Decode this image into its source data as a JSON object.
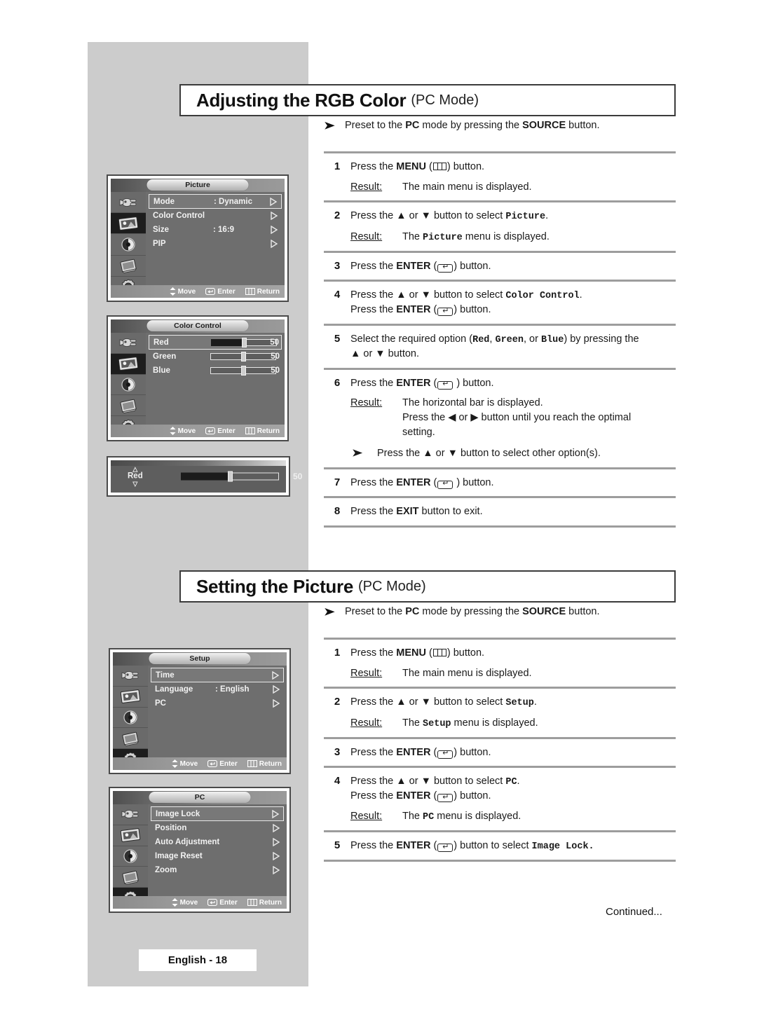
{
  "page": {
    "footer_label": "English - 18",
    "continued_label": "Continued..."
  },
  "sections": [
    {
      "id": "rgb",
      "title_main": "Adjusting the RGB Color",
      "title_sub": "(PC Mode)",
      "preset_note": {
        "arrow": "➤",
        "prefix": "Preset to the ",
        "bold1": "PC",
        "middle": " mode by pressing the ",
        "bold2": "SOURCE",
        "suffix": " button."
      },
      "steps": [
        {
          "num": "1",
          "text_parts": [
            "Press the ",
            "MENU",
            " (",
            "menu-icon",
            ") button."
          ],
          "result_label": "Result:",
          "result_text": "The main menu is displayed."
        },
        {
          "num": "2",
          "text_before": "Press the ▲ or ▼ button to select ",
          "mono": "Picture",
          "text_after": ".",
          "result_label": "Result:",
          "result_mono": "Picture",
          "result_before": "The ",
          "result_after": " menu is displayed."
        },
        {
          "num": "3",
          "enter_line": "Press the ENTER ( ) button."
        },
        {
          "num": "4",
          "line1_before": "Press the ▲ or ▼ button to select ",
          "line1_mono": "Color Control",
          "line1_after": ".",
          "line2": "Press the ENTER ( ) button."
        },
        {
          "num": "5",
          "line1_a": "Select the required option (",
          "mono1": "Red",
          "line1_b": ", ",
          "mono2": "Green",
          "line1_c": ", or ",
          "mono3": "Blue",
          "line1_d": ") by pressing the",
          "line2": "▲ or ▼ button."
        },
        {
          "num": "6",
          "enter_line": "Press the ENTER ( ) button.",
          "result_label": "Result:",
          "result_line1": "The horizontal bar is displayed.",
          "result_line2": "Press the ◀ or ▶ button until you reach the optimal",
          "result_line3": "setting.",
          "subnote_arrow": "➤",
          "subnote": "Press the ▲ or ▼ button to select other option(s)."
        },
        {
          "num": "7",
          "enter_line": "Press the ENTER ( ) button."
        },
        {
          "num": "8",
          "exit_before": "Press the ",
          "exit_bold": "EXIT",
          "exit_after": " button to exit."
        }
      ]
    },
    {
      "id": "setting-picture",
      "title_main": "Setting the Picture",
      "title_sub": "(PC Mode)",
      "preset_note": {
        "arrow": "➤",
        "prefix": "Preset to the ",
        "bold1": "PC",
        "middle": " mode by pressing the ",
        "bold2": "SOURCE",
        "suffix": " button."
      },
      "steps": [
        {
          "num": "1",
          "result_label": "Result:",
          "result_text": "The main menu is displayed."
        },
        {
          "num": "2",
          "text_before": "Press the ▲ or ▼ button to select ",
          "mono": "Setup",
          "text_after": ".",
          "result_label": "Result:",
          "result_before": "The ",
          "result_mono": "Setup",
          "result_after": " menu is displayed."
        },
        {
          "num": "3",
          "enter_line": "Press the ENTER ( ) button."
        },
        {
          "num": "4",
          "line1_before": "Press the ▲ or ▼ button to select ",
          "line1_mono": "PC",
          "line1_after": ".",
          "line2": "Press the ENTER ( ) button.",
          "result_label": "Result:",
          "result_before": "The ",
          "result_mono": "PC",
          "result_after": "  menu is displayed."
        },
        {
          "num": "5",
          "before": "Press the ",
          "bold": "ENTER",
          "middle": " (",
          "after": ") button to select ",
          "mono": "Image Lock."
        }
      ]
    }
  ],
  "osd": {
    "picture_menu": {
      "title": "Picture",
      "rows": [
        {
          "label": "Mode",
          "value": ": Dynamic",
          "selected": true,
          "chevron": true
        },
        {
          "label": "Color Control",
          "value": "",
          "selected": false,
          "chevron": true
        },
        {
          "label": "Size",
          "value": ": 16:9",
          "selected": false,
          "chevron": true
        },
        {
          "label": "PIP",
          "value": "",
          "selected": false,
          "chevron": true
        }
      ],
      "selected_sidebar_index": 1,
      "footer": {
        "move": "Move",
        "enter": "Enter",
        "return": "Return"
      }
    },
    "color_control_menu": {
      "title": "Color Control",
      "rows": [
        {
          "label": "Red",
          "value": "50",
          "fill_percent": 50,
          "selected": true,
          "filled": true
        },
        {
          "label": "Green",
          "value": "50",
          "fill_percent": 50,
          "selected": false,
          "filled": false
        },
        {
          "label": "Blue",
          "value": "50",
          "fill_percent": 50,
          "selected": false,
          "filled": false
        }
      ],
      "selected_sidebar_index": 1,
      "footer": {
        "move": "Move",
        "enter": "Enter",
        "return": "Return"
      }
    },
    "red_bar_widget": {
      "label": "Red",
      "up_arrow": "△",
      "down_arrow": "▽",
      "value": "50",
      "fill_percent": 50
    },
    "setup_menu": {
      "title": "Setup",
      "rows": [
        {
          "label": "Time",
          "value": "",
          "selected": true,
          "chevron": true
        },
        {
          "label": "Language",
          "value": ": English",
          "selected": false,
          "chevron": true
        },
        {
          "label": "PC",
          "value": "",
          "selected": false,
          "chevron": true
        }
      ],
      "selected_sidebar_index": 4,
      "footer": {
        "move": "Move",
        "enter": "Enter",
        "return": "Return"
      }
    },
    "pc_menu": {
      "title": "PC",
      "rows": [
        {
          "label": "Image Lock",
          "value": "",
          "selected": true,
          "chevron": true
        },
        {
          "label": "Position",
          "value": "",
          "selected": false,
          "chevron": true
        },
        {
          "label": "Auto Adjustment",
          "value": "",
          "selected": false,
          "chevron": true
        },
        {
          "label": "Image Reset",
          "value": "",
          "selected": false,
          "chevron": true
        },
        {
          "label": "Zoom",
          "value": "",
          "selected": false,
          "chevron": true
        }
      ],
      "selected_sidebar_index": 4,
      "footer": {
        "move": "Move",
        "enter": "Enter",
        "return": "Return"
      }
    },
    "sidebar_icons": [
      "input-plug-icon",
      "picture-screen-icon",
      "sound-speaker-icon",
      "channel-book-icon",
      "setup-gear-icon"
    ]
  },
  "colors": {
    "page_gray": "#cccccc",
    "osd_gray": "#6e6e6e",
    "osd_border": "#4a4a4a",
    "rule_gray": "#9d9d9d",
    "text": "#1a1a1a"
  }
}
